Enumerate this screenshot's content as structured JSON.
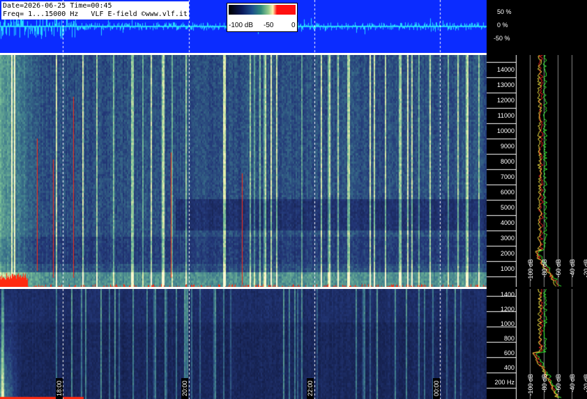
{
  "info": {
    "line1": "Date=2026-06-25 Time=00:45",
    "line2": "Freq= 1...15000 Hz   VLF E-field ©www.vlf.it"
  },
  "legend": {
    "labels": [
      "-100 dB",
      "-50",
      "0"
    ]
  },
  "waveform": {
    "percent_labels": [
      "50 %",
      "0 %",
      "-50 %"
    ]
  },
  "time_axis": {
    "labels": [
      "18:00",
      "20:00",
      "22:00",
      "00:00"
    ]
  },
  "upper_spectrogram": {
    "freq_ticks": [
      "14000",
      "13000",
      "12000",
      "11000",
      "10000",
      "9000",
      "8000",
      "7000",
      "6000",
      "5000",
      "4000",
      "3000",
      "2000",
      "1000"
    ]
  },
  "lower_spectrogram": {
    "freq_ticks": [
      "1400",
      "1200",
      "1000",
      "800",
      "600",
      "400",
      "200 Hz"
    ]
  },
  "spectrum_upper": {
    "db_labels": [
      "-100 dB",
      "-80 dB",
      "-60 dB",
      "-40 dB",
      "-20 dB"
    ]
  },
  "spectrum_lower": {
    "db_labels": [
      "-100 dB",
      "-80 dB",
      "-60 dB",
      "-40 dB",
      "-20 dB"
    ]
  },
  "colors": {
    "waveform_bg": "#0b2cff",
    "waveform_trace": "#26d8ff",
    "spectrogram_low": "#0f1d48",
    "spectrogram_mid": "#4f8f8a",
    "spectrogram_high": "#fff3a6",
    "impulse_red": "#ff2a10",
    "trace_green": "#33ff33",
    "trace_red": "#ff2020",
    "trace_yellow": "#ffee44"
  }
}
